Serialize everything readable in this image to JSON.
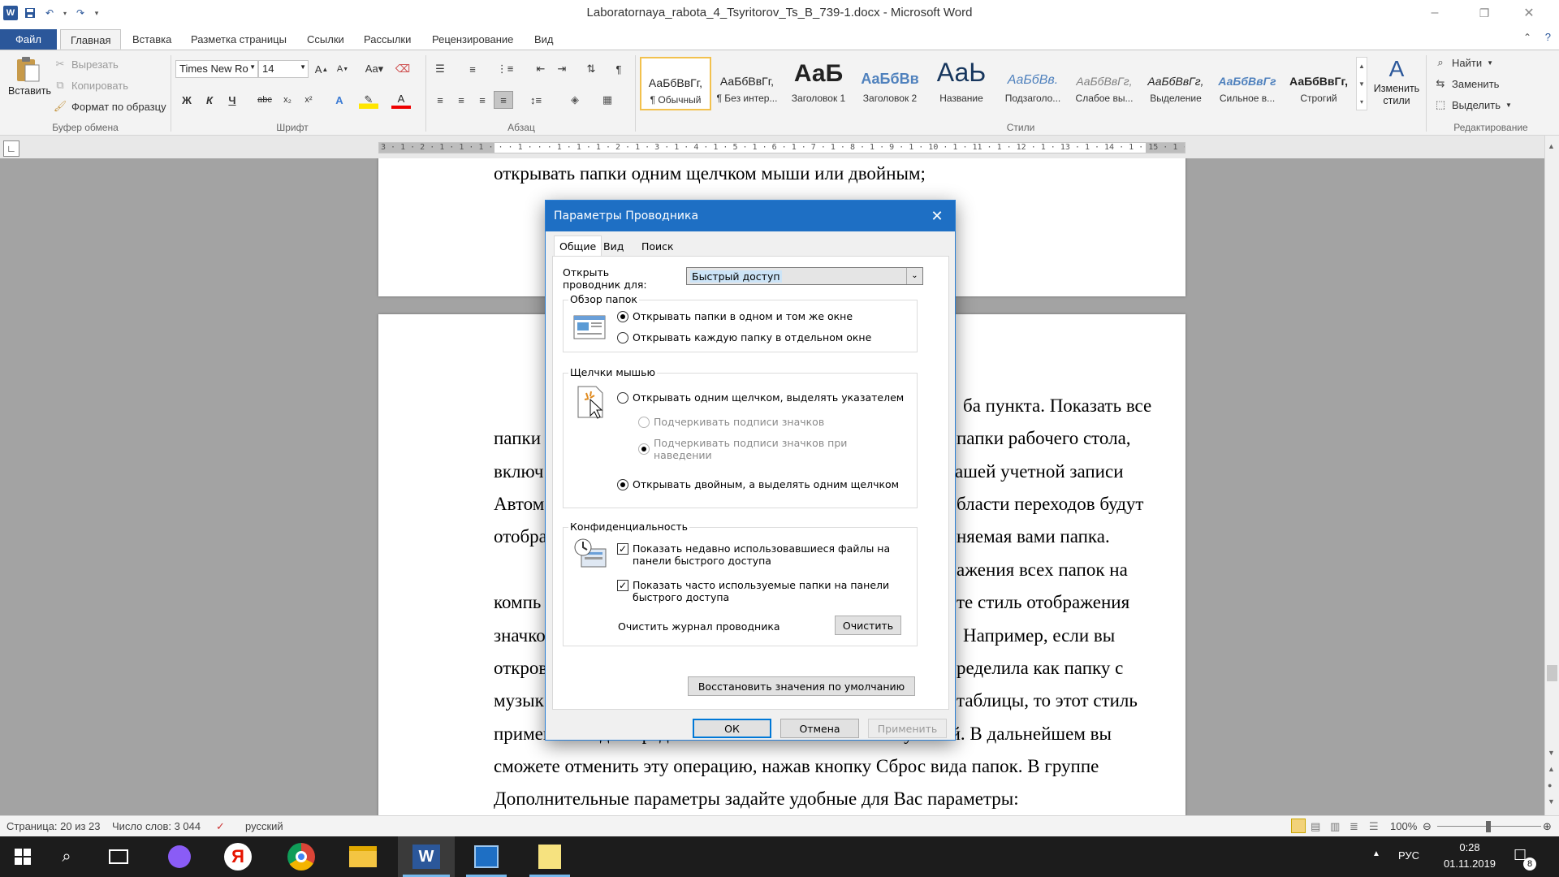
{
  "window": {
    "title": "Laboratornaya_rabota_4_Tsyritorov_Ts_B_739-1.docx - Microsoft Word",
    "app_icon": "W",
    "controls": {
      "minimize": "–",
      "restore": "❐",
      "close": "✕"
    }
  },
  "ribbon_tabs": [
    "Файл",
    "Главная",
    "Вставка",
    "Разметка страницы",
    "Ссылки",
    "Рассылки",
    "Рецензирование",
    "Вид"
  ],
  "ribbon": {
    "clipboard": {
      "paste": "Вставить",
      "cut": "Вырезать",
      "copy": "Копировать",
      "format_painter": "Формат по образцу",
      "label": "Буфер обмена"
    },
    "font": {
      "font_name": "Times New Ro",
      "font_size": "14",
      "label": "Шрифт"
    },
    "paragraph": {
      "label": "Абзац"
    },
    "styles": {
      "label": "Стили",
      "change_styles": "Изменить стили",
      "items": [
        {
          "sample": "АаБбВвГг,",
          "name": "¶ Обычный"
        },
        {
          "sample": "АаБбВвГг,",
          "name": "¶ Без интер..."
        },
        {
          "sample": "АаБ",
          "name": "Заголовок 1"
        },
        {
          "sample": "АаБбВв",
          "name": "Заголовок 2"
        },
        {
          "sample": "АаЬ",
          "name": "Название"
        },
        {
          "sample": "АаБбВв.",
          "name": "Подзаголо..."
        },
        {
          "sample": "АаБбВвГг,",
          "name": "Слабое вы..."
        },
        {
          "sample": "АаБбВвГг,",
          "name": "Выделение"
        },
        {
          "sample": "АаБбВвГг",
          "name": "Сильное в..."
        },
        {
          "sample": "АаБбВвГг,",
          "name": "Строгий"
        }
      ]
    },
    "editing": {
      "find": "Найти",
      "replace": "Заменить",
      "select": "Выделить",
      "label": "Редактирование"
    }
  },
  "ruler": {
    "text": "3 · 1 · 2 · 1 · 1 · 1 · · · 1 · · · 1 · 1 · 1 · 2 · 1 · 3 · 1 · 4 · 1 · 5 · 1 · 6 · 1 · 7 · 1 · 8 · 1 · 9 · 1 · 10 · 1 · 11 · 1 · 12 · 1 · 13 · 1 · 14 · 1 · 15 · 1 · 16 · 1 · · · 1"
  },
  "document": {
    "page1_line": "открывать папки одним щелчком мыши или двойным;",
    "left_fragments": [
      "папки",
      "включ",
      "Автом",
      "отобра",
      "компь",
      "значко",
      "откров",
      "музык",
      "применяться для представления ко всем папкам с музыкой. В дальнейшем вы"
    ],
    "right_fragments": [
      "ба пункта. Показать все",
      "папки рабочего стола,",
      "ашей учетной записи",
      "бласти переходов будут",
      "няемая вами папка.",
      "ажения всех папок на",
      "те стиль отображения",
      "Например, если вы",
      "ределила как папку с",
      "таблицы, то этот стиль"
    ],
    "full_lines": [
      "сможете отменить эту операцию, нажав кнопку Сброс вида папок. В группе",
      "Дополнительные параметры задайте удобные для Вас параметры:"
    ]
  },
  "dialog": {
    "title": "Параметры Проводника",
    "tabs": [
      "Общие",
      "Вид",
      "Поиск"
    ],
    "open_for_label": "Открыть проводник для:",
    "open_for_value": "Быстрый доступ",
    "browse": {
      "legend": "Обзор папок",
      "options": [
        "Открывать папки в одном и том же окне",
        "Открывать каждую папку в отдельном окне"
      ]
    },
    "clicks": {
      "legend": "Щелчки мышью",
      "single": "Открывать одним щелчком, выделять указателем",
      "underline_always": "Подчеркивать подписи значков",
      "underline_hover": "Подчеркивать подписи значков при наведении",
      "double": "Открывать двойным, а выделять одним щелчком"
    },
    "privacy": {
      "legend": "Конфиденциальность",
      "recent_files": "Показать недавно использовавшиеся файлы на панели быстрого доступа",
      "frequent_folders": "Показать часто используемые папки на панели быстрого доступа",
      "clear_label": "Очистить журнал проводника",
      "clear_button": "Очистить"
    },
    "restore_defaults": "Восстановить значения по умолчанию",
    "ok": "ОК",
    "cancel": "Отмена",
    "apply": "Применить"
  },
  "statusbar": {
    "page": "Страница: 20 из 23",
    "words": "Число слов: 3 044",
    "language": "русский",
    "zoom": "100%"
  },
  "taskbar": {
    "language": "РУС",
    "time": "0:28",
    "date": "01.11.2019",
    "notifications": "8"
  },
  "colors": {
    "accent": "#2b579a",
    "dialog_title": "#1e6fc4",
    "taskbar": "#1c1c1c"
  }
}
